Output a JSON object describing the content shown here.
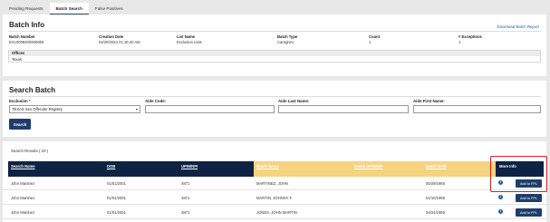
{
  "tabs": [
    {
      "label": "Pending Requests",
      "active": false
    },
    {
      "label": "Batch Search",
      "active": true
    },
    {
      "label": "False Positives",
      "active": false
    }
  ],
  "batch_info": {
    "title": "Batch Info",
    "download_link": "Download Batch Report",
    "fields": {
      "batch_number": {
        "label": "Batch Number",
        "value": "EXL0009400000065"
      },
      "creation_date": {
        "label": "Creation Date",
        "value": "02/29/2024 01:16:40 AM"
      },
      "list_name": {
        "label": "List Name",
        "value": "Exclusion Lists"
      },
      "batch_type": {
        "label": "Batch Type",
        "value": "Caregiver"
      },
      "count": {
        "label": "Count",
        "value": "1"
      },
      "exceptions": {
        "label": "# Exceptions",
        "value": "1"
      }
    },
    "offices": {
      "label": "Offices",
      "value": "Texas"
    }
  },
  "search_batch": {
    "title": "Search Batch",
    "exclusion_label": "Exclusion",
    "exclusion_required": "*",
    "exclusion_value": "TEXAS Sex Offender Registry",
    "aide_code_label": "Aide Code:",
    "aide_last_label": "Aide Last Name:",
    "aide_first_label": "Aide First Name:",
    "search_button": "Search"
  },
  "results": {
    "count_text": "Search Results ( 20 )",
    "columns": [
      "Search Name",
      "DOB",
      "UPIN/NPI",
      "Match Name",
      "Match UPIN/NPI",
      "Match DOB",
      "More Info"
    ],
    "rows": [
      {
        "search_name": "John Martinez",
        "dob": "01/01/2001",
        "upin": "4871",
        "match_name": "MARTINEZ, JOHN",
        "match_upin": "",
        "match_dob": "05/29/1965",
        "info": "i",
        "action": "Add to FPL"
      },
      {
        "search_name": "John Martinez",
        "dob": "01/01/2001",
        "upin": "4871",
        "match_name": "MARTIN, JOHNNY F",
        "match_upin": "",
        "match_dob": "01/10/1965",
        "info": "i",
        "action": "Add to FPL"
      },
      {
        "search_name": "John Martinez",
        "dob": "01/01/2001",
        "upin": "4871",
        "match_name": "JONES, JOHN MARTIN",
        "match_upin": "",
        "match_dob": "04/24/1955",
        "info": "i",
        "action": "Add to FPL"
      }
    ]
  },
  "colors": {
    "navy": "#0e2244",
    "gold": "#f6d37e",
    "button": "#1f3d6b",
    "link": "#1a5fb4",
    "highlight": "#d32020"
  },
  "icons": {
    "dropdown": "chevron-down-icon",
    "info": "info-icon"
  }
}
